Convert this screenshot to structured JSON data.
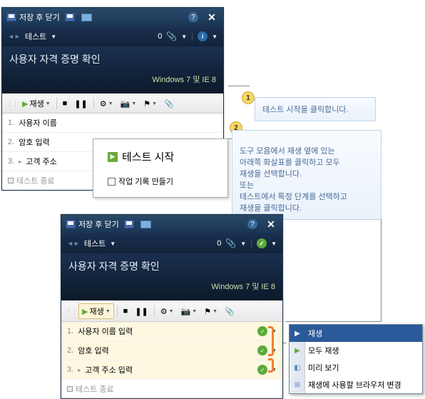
{
  "window1": {
    "toolbar_title": "저장 후 닫기",
    "tab": "테스트",
    "count": "0",
    "title": "사용자 자격 증명 확인",
    "env": "Windows 7 및 IE 8",
    "play_label": "재생",
    "steps": [
      {
        "num": "1.",
        "text": "사용자 이름"
      },
      {
        "num": "2.",
        "text": "암호 입력"
      },
      {
        "num": "3.",
        "prefix": "▸",
        "text": "고객 주소"
      }
    ],
    "end": "테스트 종료"
  },
  "popup": {
    "title": "테스트 시작",
    "checkbox": "작업 기록 만들기"
  },
  "callout1": "테스트 시작을 클릭합니다.",
  "callout2": "도구 모음에서 재생 옆에 있는\n아래쪽 화살표를 클릭하고 모두\n재생을 선택합니다.\n또는\n테스트에서 특정 단계를 선택하고\n재생을 클릭합니다.",
  "window2": {
    "toolbar_title": "저장 후 닫기",
    "tab": "테스트",
    "count": "0",
    "title": "사용자 자격 증명 확인",
    "env": "Windows 7 및 IE 8",
    "play_label": "재생",
    "steps": [
      {
        "num": "1.",
        "text": "사용자 이름 입력"
      },
      {
        "num": "2.",
        "text": "암호 입력"
      },
      {
        "num": "3.",
        "prefix": "▸",
        "text": "고객 주소 입력"
      }
    ],
    "end": "테스트 종료"
  },
  "menu": {
    "items": [
      "재생",
      "모두 재생",
      "미리 보기",
      "재생에 사용할 브라우저 변경"
    ]
  }
}
